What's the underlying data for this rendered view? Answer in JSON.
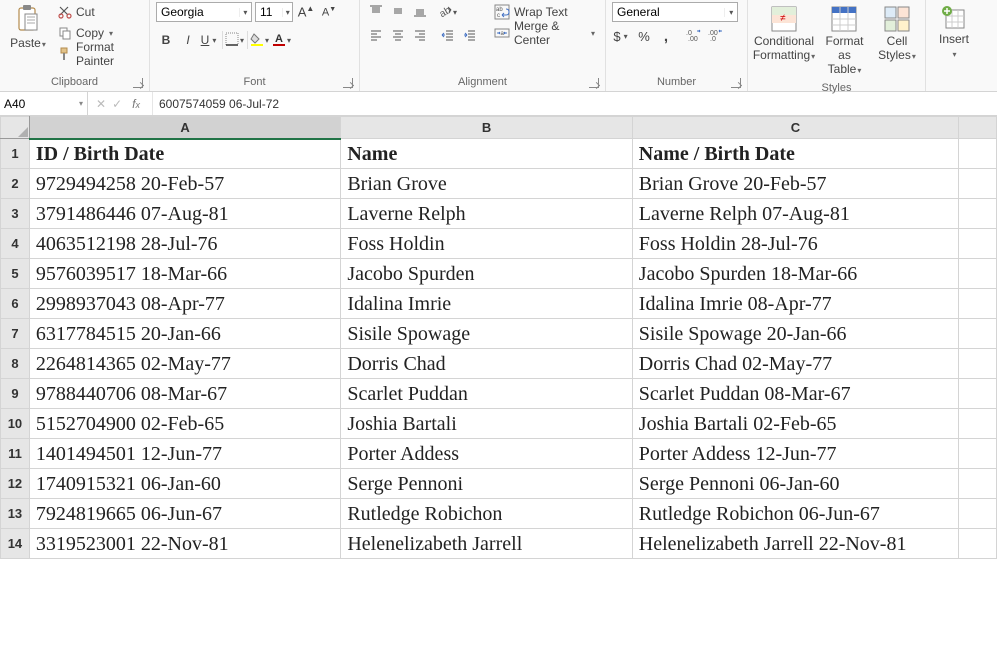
{
  "ribbon": {
    "clipboard": {
      "paste": "Paste",
      "cut": "Cut",
      "copy": "Copy",
      "format_painter": "Format Painter",
      "label": "Clipboard"
    },
    "font": {
      "name": "Georgia",
      "size": "11",
      "label": "Font"
    },
    "alignment": {
      "wrap": "Wrap Text",
      "merge": "Merge & Center",
      "label": "Alignment"
    },
    "number": {
      "format_name": "General",
      "label": "Number"
    },
    "styles": {
      "conditional": "Conditional\nFormatting",
      "table": "Format as\nTable",
      "cell": "Cell\nStyles",
      "label": "Styles"
    },
    "cells": {
      "insert": "Insert"
    }
  },
  "formula_bar": {
    "cell_ref": "A40",
    "formula": "6007574059 06-Jul-72"
  },
  "columns": [
    "A",
    "B",
    "C"
  ],
  "headers": {
    "a": "ID / Birth Date",
    "b": "Name",
    "c": "Name / Birth Date"
  },
  "rows": [
    {
      "n": "2",
      "a": "9729494258 20-Feb-57",
      "b": "Brian Grove",
      "c": "Brian Grove 20-Feb-57"
    },
    {
      "n": "3",
      "a": "3791486446 07-Aug-81",
      "b": "Laverne Relph",
      "c": "Laverne Relph 07-Aug-81"
    },
    {
      "n": "4",
      "a": "4063512198 28-Jul-76",
      "b": "Foss Holdin",
      "c": "Foss Holdin 28-Jul-76"
    },
    {
      "n": "5",
      "a": "9576039517 18-Mar-66",
      "b": "Jacobo Spurden",
      "c": "Jacobo Spurden 18-Mar-66"
    },
    {
      "n": "6",
      "a": "2998937043 08-Apr-77",
      "b": "Idalina Imrie",
      "c": "Idalina Imrie 08-Apr-77"
    },
    {
      "n": "7",
      "a": "6317784515 20-Jan-66",
      "b": "Sisile Spowage",
      "c": "Sisile Spowage 20-Jan-66"
    },
    {
      "n": "8",
      "a": "2264814365 02-May-77",
      "b": "Dorris Chad",
      "c": "Dorris Chad 02-May-77"
    },
    {
      "n": "9",
      "a": "9788440706 08-Mar-67",
      "b": "Scarlet Puddan",
      "c": "Scarlet Puddan 08-Mar-67"
    },
    {
      "n": "10",
      "a": "5152704900 02-Feb-65",
      "b": "Joshia Bartali",
      "c": "Joshia Bartali 02-Feb-65"
    },
    {
      "n": "11",
      "a": "1401494501 12-Jun-77",
      "b": "Porter Addess",
      "c": "Porter Addess 12-Jun-77"
    },
    {
      "n": "12",
      "a": "1740915321 06-Jan-60",
      "b": "Serge Pennoni",
      "c": "Serge Pennoni 06-Jan-60"
    },
    {
      "n": "13",
      "a": "7924819665 06-Jun-67",
      "b": "Rutledge Robichon",
      "c": "Rutledge Robichon 06-Jun-67"
    },
    {
      "n": "14",
      "a": "3319523001 22-Nov-81",
      "b": "Helenelizabeth Jarrell",
      "c": "Helenelizabeth Jarrell 22-Nov-81"
    }
  ]
}
